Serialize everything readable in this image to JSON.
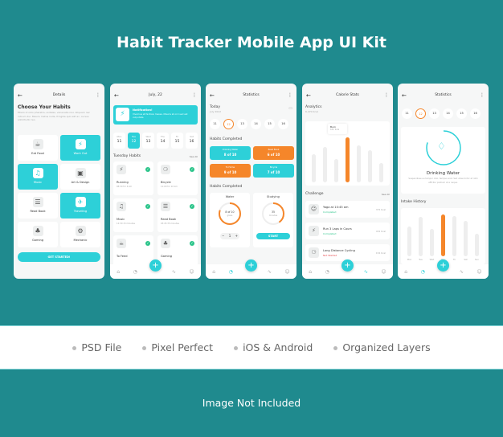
{
  "header": {
    "title": "Habit Tracker Mobile App UI Kit"
  },
  "features": [
    "PSD File",
    "Pixel Perfect",
    "iOS & Android",
    "Organized Layers"
  ],
  "footer": {
    "note": "Image Not Included"
  },
  "colors": {
    "background": "#1f8a8e",
    "accent": "#2dd0d8",
    "orange": "#f5862a",
    "success": "#2bc48a",
    "danger": "#e5484d"
  },
  "nav_icons": [
    "home-icon",
    "clock-icon",
    "activity-icon",
    "user-icon"
  ],
  "screens": {
    "details": {
      "title": "Details",
      "heading": "Choose Your Habits",
      "description": "Etiam id odio pharetra, sodales, venenatis nisi. Aliquam nec rutrum dui. Mauris metus nulla, fringilla quis elit ac, cursus sollicitudin leo.",
      "habits": [
        {
          "label": "Eat Food",
          "icon": "food-icon",
          "selected": false
        },
        {
          "label": "Work Out",
          "icon": "running-icon",
          "selected": true
        },
        {
          "label": "Music",
          "icon": "music-icon",
          "selected": true
        },
        {
          "label": "Art & Design",
          "icon": "art-icon",
          "selected": false
        },
        {
          "label": "Read Book",
          "icon": "book-icon",
          "selected": false
        },
        {
          "label": "Traveling",
          "icon": "plane-icon",
          "selected": true
        },
        {
          "label": "Gaming",
          "icon": "gamepad-icon",
          "selected": false
        },
        {
          "label": "Mechanic",
          "icon": "gear-icon",
          "selected": false
        }
      ],
      "cta": "GET STARTED!"
    },
    "daily": {
      "title": "July, 22",
      "notification": {
        "title": "Notification!",
        "text": "Vivamus et facilisis massa. Mauris at orci sed est vulputate."
      },
      "days": [
        {
          "name": "Mon",
          "num": "11"
        },
        {
          "name": "Tue",
          "num": "12"
        },
        {
          "name": "Wed",
          "num": "13"
        },
        {
          "name": "Thu",
          "num": "14"
        },
        {
          "name": "Fri",
          "num": "15"
        },
        {
          "name": "Sat",
          "num": "16"
        }
      ],
      "selected_day": 1,
      "section": "Tuesday Habits",
      "see_all": "See All",
      "habits": [
        {
          "name": "Running",
          "detail": "08:30 for 4 km",
          "icon": "running-icon",
          "done": true
        },
        {
          "name": "Bicycle",
          "detail": "11:00 for 10 km",
          "icon": "bicycle-icon",
          "done": true
        },
        {
          "name": "Music",
          "detail": "12:30 15 minutes",
          "icon": "music-icon",
          "done": true
        },
        {
          "name": "Read Book",
          "detail": "03:45 35 minutes",
          "icon": "book-icon",
          "done": true
        },
        {
          "name": "To Feed",
          "detail": "",
          "icon": "food-icon",
          "done": true
        },
        {
          "name": "Gaming",
          "detail": "",
          "icon": "gamepad-icon",
          "done": true
        }
      ]
    },
    "statistics": {
      "title": "Statistics",
      "today": "Today",
      "date": "July 2022",
      "days": [
        "11",
        "12",
        "13",
        "14",
        "15",
        "16"
      ],
      "selected_day": 1,
      "section1": "Habits Completed",
      "cards": [
        {
          "name": "Drinking Water",
          "value": "8 of 10",
          "color": "accent"
        },
        {
          "name": "Read Book",
          "value": "6 of 10",
          "color": "orange"
        },
        {
          "name": "To Home",
          "value": "9 of 10",
          "color": "orange"
        },
        {
          "name": "Bicycle",
          "value": "7 of 10",
          "color": "accent"
        }
      ],
      "section2": "Habits Completed",
      "water": {
        "label": "Water",
        "value": "8 of 10",
        "unit": "glass",
        "progress": 0.8,
        "count": "1",
        "minus": "−",
        "plus": "+"
      },
      "studying": {
        "label": "Studying",
        "value": "35",
        "unit": "minutes",
        "progress": 0.4,
        "button": "START"
      }
    },
    "calorie": {
      "title": "Calorie Stats",
      "section": "Analytics",
      "total": "6,470 Kcal",
      "tooltip": {
        "label": "Burn",
        "value": "632 Kcal"
      },
      "bars": [
        60,
        75,
        50,
        95,
        78,
        68,
        40
      ],
      "highlight": 3,
      "challenge": "Challenge",
      "see_all": "See All",
      "items": [
        {
          "name": "Yoga at 10:45 am",
          "status": "Completed",
          "kcal": "375 Kcal",
          "icon": "yoga-icon",
          "state": "success"
        },
        {
          "name": "Run 3 Laps in Cours",
          "status": "Completed",
          "kcal": "432 Kcal",
          "icon": "running-icon",
          "state": "success"
        },
        {
          "name": "Long Distance Cycling",
          "status": "Not Started",
          "kcal": "154 Kcal",
          "icon": "bicycle-icon",
          "state": "danger"
        }
      ]
    },
    "water": {
      "title": "Statistics",
      "days": [
        "11",
        "12",
        "13",
        "14",
        "15",
        "16"
      ],
      "selected_day": 1,
      "progress": 0.8,
      "name": "Drinking Water",
      "description": "Suspendisse eu tempor odio, tempus erat. Sed vitae tortor at nibh efficitur pretium at a neque.",
      "section": "Intake History",
      "bars": [
        60,
        80,
        55,
        85,
        82,
        72,
        45
      ],
      "highlight": 3,
      "labels": [
        "Mon",
        "Tue",
        "Wed",
        "Thu",
        "Fri",
        "Sat",
        "Sun"
      ]
    }
  }
}
